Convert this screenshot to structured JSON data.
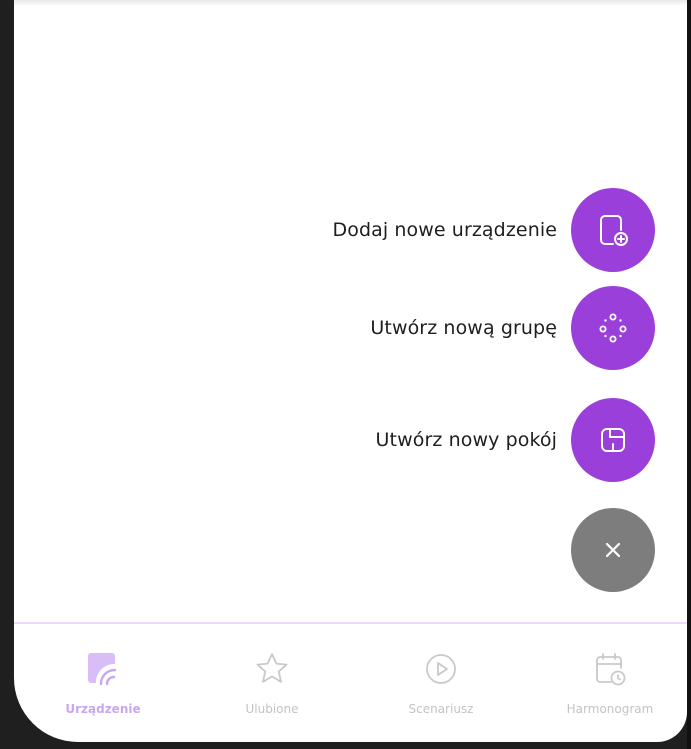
{
  "fab_menu": {
    "items": [
      {
        "label": "Dodaj nowe urządzenie",
        "icon": "add-device-icon"
      },
      {
        "label": "Utwórz nową grupę",
        "icon": "group-dots-icon"
      },
      {
        "label": "Utwórz nowy pokój",
        "icon": "room-layout-icon"
      }
    ],
    "close_icon": "close-icon"
  },
  "bottom_nav": {
    "items": [
      {
        "label": "Urządzenie",
        "icon": "device-icon",
        "active": true
      },
      {
        "label": "Ulubione",
        "icon": "star-icon",
        "active": false
      },
      {
        "label": "Scenariusz",
        "icon": "play-icon",
        "active": false
      },
      {
        "label": "Harmonogram",
        "icon": "calendar-clock-icon",
        "active": false
      }
    ]
  },
  "colors": {
    "accent": "#9a3fd9",
    "close_fab": "#7d7d7d",
    "nav_active": "#c8a7ee",
    "nav_inactive": "#c4c4c4",
    "divider": "#ecd9fb"
  }
}
